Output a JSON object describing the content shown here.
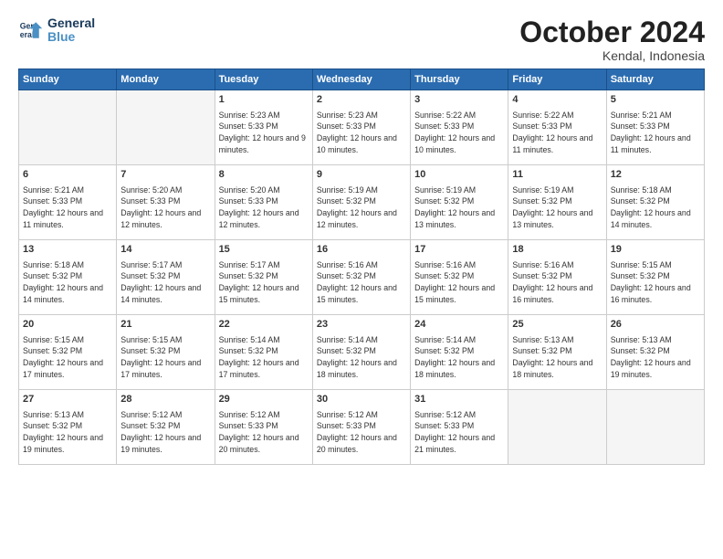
{
  "logo": {
    "text1": "General",
    "text2": "Blue"
  },
  "title": "October 2024",
  "subtitle": "Kendal, Indonesia",
  "days_header": [
    "Sunday",
    "Monday",
    "Tuesday",
    "Wednesday",
    "Thursday",
    "Friday",
    "Saturday"
  ],
  "weeks": [
    [
      {
        "day": "",
        "empty": true
      },
      {
        "day": "",
        "empty": true
      },
      {
        "day": "1",
        "sunrise": "Sunrise: 5:23 AM",
        "sunset": "Sunset: 5:33 PM",
        "daylight": "Daylight: 12 hours and 9 minutes."
      },
      {
        "day": "2",
        "sunrise": "Sunrise: 5:23 AM",
        "sunset": "Sunset: 5:33 PM",
        "daylight": "Daylight: 12 hours and 10 minutes."
      },
      {
        "day": "3",
        "sunrise": "Sunrise: 5:22 AM",
        "sunset": "Sunset: 5:33 PM",
        "daylight": "Daylight: 12 hours and 10 minutes."
      },
      {
        "day": "4",
        "sunrise": "Sunrise: 5:22 AM",
        "sunset": "Sunset: 5:33 PM",
        "daylight": "Daylight: 12 hours and 11 minutes."
      },
      {
        "day": "5",
        "sunrise": "Sunrise: 5:21 AM",
        "sunset": "Sunset: 5:33 PM",
        "daylight": "Daylight: 12 hours and 11 minutes."
      }
    ],
    [
      {
        "day": "6",
        "sunrise": "Sunrise: 5:21 AM",
        "sunset": "Sunset: 5:33 PM",
        "daylight": "Daylight: 12 hours and 11 minutes."
      },
      {
        "day": "7",
        "sunrise": "Sunrise: 5:20 AM",
        "sunset": "Sunset: 5:33 PM",
        "daylight": "Daylight: 12 hours and 12 minutes."
      },
      {
        "day": "8",
        "sunrise": "Sunrise: 5:20 AM",
        "sunset": "Sunset: 5:33 PM",
        "daylight": "Daylight: 12 hours and 12 minutes."
      },
      {
        "day": "9",
        "sunrise": "Sunrise: 5:19 AM",
        "sunset": "Sunset: 5:32 PM",
        "daylight": "Daylight: 12 hours and 12 minutes."
      },
      {
        "day": "10",
        "sunrise": "Sunrise: 5:19 AM",
        "sunset": "Sunset: 5:32 PM",
        "daylight": "Daylight: 12 hours and 13 minutes."
      },
      {
        "day": "11",
        "sunrise": "Sunrise: 5:19 AM",
        "sunset": "Sunset: 5:32 PM",
        "daylight": "Daylight: 12 hours and 13 minutes."
      },
      {
        "day": "12",
        "sunrise": "Sunrise: 5:18 AM",
        "sunset": "Sunset: 5:32 PM",
        "daylight": "Daylight: 12 hours and 14 minutes."
      }
    ],
    [
      {
        "day": "13",
        "sunrise": "Sunrise: 5:18 AM",
        "sunset": "Sunset: 5:32 PM",
        "daylight": "Daylight: 12 hours and 14 minutes."
      },
      {
        "day": "14",
        "sunrise": "Sunrise: 5:17 AM",
        "sunset": "Sunset: 5:32 PM",
        "daylight": "Daylight: 12 hours and 14 minutes."
      },
      {
        "day": "15",
        "sunrise": "Sunrise: 5:17 AM",
        "sunset": "Sunset: 5:32 PM",
        "daylight": "Daylight: 12 hours and 15 minutes."
      },
      {
        "day": "16",
        "sunrise": "Sunrise: 5:16 AM",
        "sunset": "Sunset: 5:32 PM",
        "daylight": "Daylight: 12 hours and 15 minutes."
      },
      {
        "day": "17",
        "sunrise": "Sunrise: 5:16 AM",
        "sunset": "Sunset: 5:32 PM",
        "daylight": "Daylight: 12 hours and 15 minutes."
      },
      {
        "day": "18",
        "sunrise": "Sunrise: 5:16 AM",
        "sunset": "Sunset: 5:32 PM",
        "daylight": "Daylight: 12 hours and 16 minutes."
      },
      {
        "day": "19",
        "sunrise": "Sunrise: 5:15 AM",
        "sunset": "Sunset: 5:32 PM",
        "daylight": "Daylight: 12 hours and 16 minutes."
      }
    ],
    [
      {
        "day": "20",
        "sunrise": "Sunrise: 5:15 AM",
        "sunset": "Sunset: 5:32 PM",
        "daylight": "Daylight: 12 hours and 17 minutes."
      },
      {
        "day": "21",
        "sunrise": "Sunrise: 5:15 AM",
        "sunset": "Sunset: 5:32 PM",
        "daylight": "Daylight: 12 hours and 17 minutes."
      },
      {
        "day": "22",
        "sunrise": "Sunrise: 5:14 AM",
        "sunset": "Sunset: 5:32 PM",
        "daylight": "Daylight: 12 hours and 17 minutes."
      },
      {
        "day": "23",
        "sunrise": "Sunrise: 5:14 AM",
        "sunset": "Sunset: 5:32 PM",
        "daylight": "Daylight: 12 hours and 18 minutes."
      },
      {
        "day": "24",
        "sunrise": "Sunrise: 5:14 AM",
        "sunset": "Sunset: 5:32 PM",
        "daylight": "Daylight: 12 hours and 18 minutes."
      },
      {
        "day": "25",
        "sunrise": "Sunrise: 5:13 AM",
        "sunset": "Sunset: 5:32 PM",
        "daylight": "Daylight: 12 hours and 18 minutes."
      },
      {
        "day": "26",
        "sunrise": "Sunrise: 5:13 AM",
        "sunset": "Sunset: 5:32 PM",
        "daylight": "Daylight: 12 hours and 19 minutes."
      }
    ],
    [
      {
        "day": "27",
        "sunrise": "Sunrise: 5:13 AM",
        "sunset": "Sunset: 5:32 PM",
        "daylight": "Daylight: 12 hours and 19 minutes."
      },
      {
        "day": "28",
        "sunrise": "Sunrise: 5:12 AM",
        "sunset": "Sunset: 5:32 PM",
        "daylight": "Daylight: 12 hours and 19 minutes."
      },
      {
        "day": "29",
        "sunrise": "Sunrise: 5:12 AM",
        "sunset": "Sunset: 5:33 PM",
        "daylight": "Daylight: 12 hours and 20 minutes."
      },
      {
        "day": "30",
        "sunrise": "Sunrise: 5:12 AM",
        "sunset": "Sunset: 5:33 PM",
        "daylight": "Daylight: 12 hours and 20 minutes."
      },
      {
        "day": "31",
        "sunrise": "Sunrise: 5:12 AM",
        "sunset": "Sunset: 5:33 PM",
        "daylight": "Daylight: 12 hours and 21 minutes."
      },
      {
        "day": "",
        "empty": true
      },
      {
        "day": "",
        "empty": true
      }
    ]
  ]
}
